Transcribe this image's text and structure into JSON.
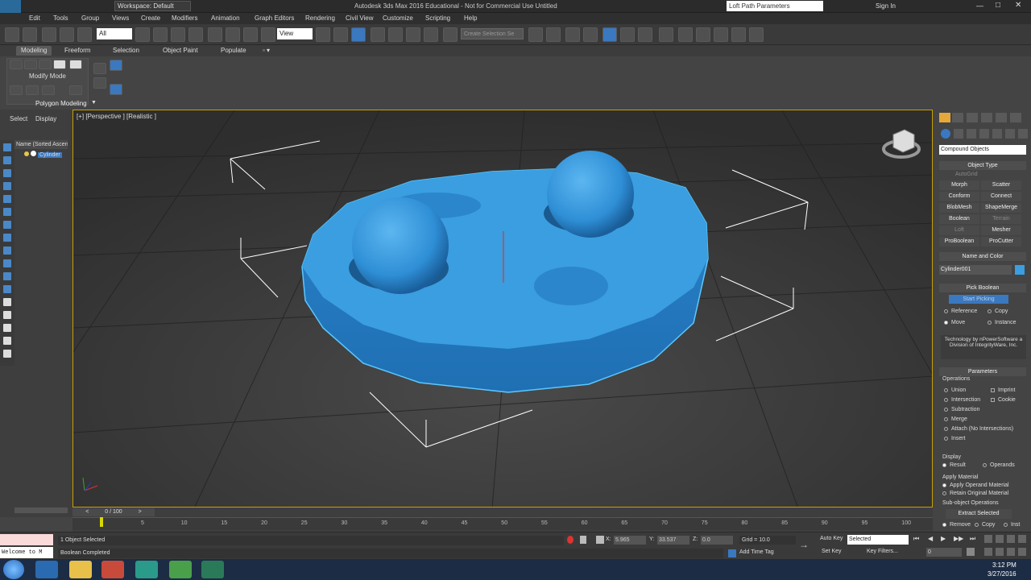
{
  "titlebar": {
    "workspace": "Workspace: Default",
    "title": "Autodesk 3ds Max 2016 Educational - Not for Commercial Use    Untitled",
    "search_placeholder": "Loft Path Parameters",
    "sign_in": "Sign In"
  },
  "menu": [
    "Edit",
    "Tools",
    "Group",
    "Views",
    "Create",
    "Modifiers",
    "Animation",
    "Graph Editors",
    "Rendering",
    "Civil View",
    "Customize",
    "Scripting",
    "Help"
  ],
  "toolbar": {
    "filter_value": "All",
    "view_value": "View",
    "selection_set_placeholder": "Create Selection Se"
  },
  "ribbon": {
    "tabs": [
      "Modeling",
      "Freeform",
      "Selection",
      "Object Paint",
      "Populate"
    ],
    "mode": "Modify Mode",
    "panel": "Polygon Modeling"
  },
  "scene_explorer": {
    "tabs": [
      "Select",
      "Display"
    ],
    "column_header": "Name (Sorted Ascen",
    "items": [
      "Cylinder"
    ]
  },
  "viewport": {
    "label": "[+] [Perspective ] [Realistic ]"
  },
  "command_panel": {
    "category": "Compound Objects",
    "object_type": {
      "title": "Object Type",
      "autogrid": "AutoGrid",
      "buttons": [
        "Morph",
        "Scatter",
        "Conform",
        "Connect",
        "BlobMesh",
        "ShapeMerge",
        "Boolean",
        "Terrain",
        "Loft",
        "Mesher",
        "ProBoolean",
        "ProCutter"
      ]
    },
    "name_color": {
      "title": "Name and Color",
      "name": "Cylinder001",
      "color": "#3a9ee0"
    },
    "pick_boolean": {
      "title": "Pick Boolean",
      "start_picking": "Start Picking",
      "options": [
        "Reference",
        "Copy",
        "Move",
        "Instance"
      ],
      "selected": "Move",
      "credit": "Technology by nPowerSoftware a Division of IntegrityWare, Inc."
    },
    "parameters": {
      "title": "Parameters",
      "operations_label": "Operations",
      "operations": [
        "Union",
        "Intersection",
        "Subtraction",
        "Merge",
        "Attach (No Intersections)",
        "Insert"
      ],
      "checkboxes": [
        "Imprint",
        "Cookie"
      ],
      "display_label": "Display",
      "display": [
        "Result",
        "Operands"
      ],
      "apply_material_label": "Apply Material",
      "apply_material": [
        "Apply Operand Material",
        "Retain Original Material"
      ],
      "subobject_label": "Sub-object Operations",
      "extract_selected": "Extract Selected",
      "remove_row": [
        "Remove",
        "Copy",
        "Inst"
      ]
    }
  },
  "timeline": {
    "frame": "0 / 100",
    "ticks": [
      "5",
      "10",
      "15",
      "20",
      "25",
      "30",
      "35",
      "40",
      "45",
      "50",
      "55",
      "60",
      "65",
      "70",
      "75",
      "80",
      "85",
      "90",
      "95",
      "100"
    ]
  },
  "status": {
    "selected": "1 Object Selected",
    "prompt": "Boolean Completed",
    "maxscript": "Welcome to M",
    "x_label": "X:",
    "x_value": "5.965",
    "y_label": "Y:",
    "y_value": "33.537",
    "z_label": "Z:",
    "z_value": "0.0",
    "grid": "Grid = 10.0",
    "add_time_tag": "Add Time Tag",
    "auto_key": "Auto Key",
    "set_key": "Set Key",
    "selected_dropdown": "Selected",
    "key_filters": "Key Filters...",
    "frame_value": "0"
  },
  "taskbar": {
    "time": "3:12 PM",
    "date": "3/27/2016"
  },
  "colors": {
    "object": "#3a9ee0",
    "viewport_border": "#c8a000",
    "start_picking": "#3a78c0"
  }
}
